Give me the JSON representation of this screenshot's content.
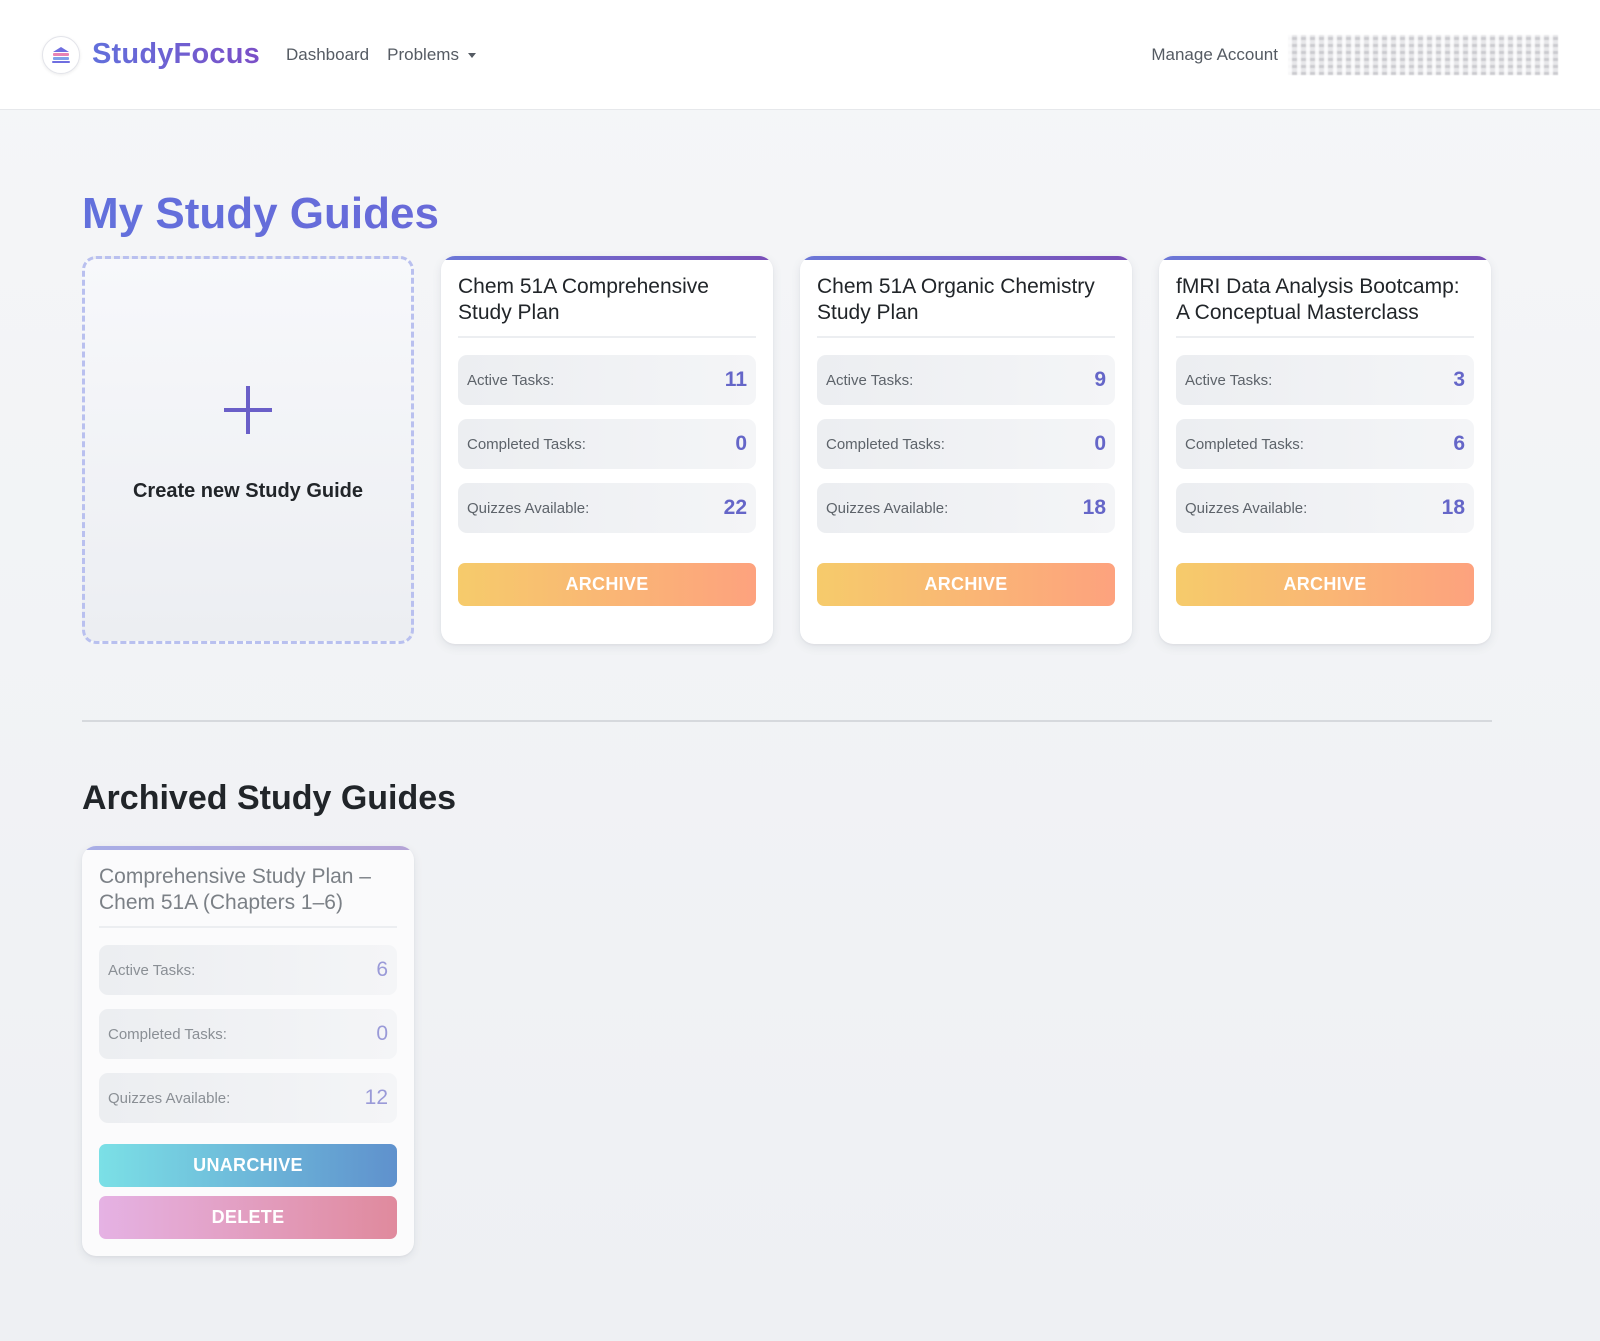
{
  "navbar": {
    "brand": "StudyFocus",
    "links": [
      {
        "label": "Dashboard"
      },
      {
        "label": "Problems"
      }
    ],
    "manage_account": "Manage Account"
  },
  "main": {
    "title": "My Study Guides",
    "create_label": "Create new Study Guide",
    "stat_labels": {
      "active": "Active Tasks:",
      "completed": "Completed Tasks:",
      "quizzes": "Quizzes Available:"
    },
    "guides": [
      {
        "title": "Chem 51A Comprehensive Study Plan",
        "active": "11",
        "completed": "0",
        "quizzes": "22",
        "button": "ARCHIVE"
      },
      {
        "title": "Chem 51A Organic Chemistry Study Plan",
        "active": "9",
        "completed": "0",
        "quizzes": "18",
        "button": "ARCHIVE"
      },
      {
        "title": "fMRI Data Analysis Bootcamp: A Conceptual Masterclass",
        "active": "3",
        "completed": "6",
        "quizzes": "18",
        "button": "ARCHIVE"
      }
    ]
  },
  "archived": {
    "title": "Archived Study Guides",
    "guides": [
      {
        "title": "Comprehensive Study Plan – Chem 51A (Chapters 1–6)",
        "active": "6",
        "completed": "0",
        "quizzes": "12",
        "unarchive": "UNARCHIVE",
        "delete": "DELETE"
      }
    ]
  },
  "icons": {
    "brand": "book-stack-icon",
    "create": "plus-icon",
    "problems_dropdown": "caret-down-icon"
  },
  "colors": {
    "brand": "#6a5acd",
    "archive_button": "#fbb575",
    "unarchive_button": "#6cb8da",
    "delete_button": "#e29cbf",
    "stat_value": "#6566c8"
  }
}
